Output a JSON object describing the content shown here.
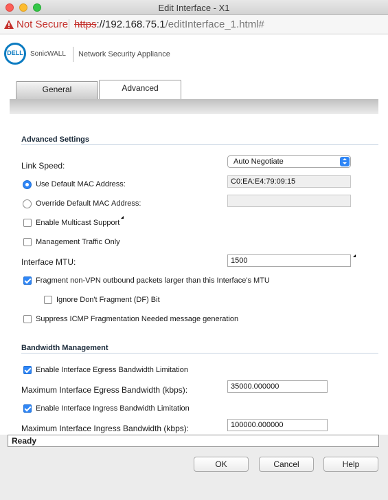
{
  "window": {
    "title": "Edit Interface - X1"
  },
  "address_bar": {
    "security_label": "Not Secure",
    "url_scheme": "https",
    "url_host": "://192.168.75.1",
    "url_path": "/editInterface_1.html#"
  },
  "header": {
    "logo_text": "DELL",
    "brand": "SonicWALL",
    "product": "Network Security Appliance"
  },
  "tabs": [
    {
      "label": "General",
      "active": false
    },
    {
      "label": "Advanced",
      "active": true
    }
  ],
  "advanced_settings": {
    "title": "Advanced Settings",
    "link_speed_label": "Link Speed:",
    "link_speed_value": "Auto Negotiate",
    "use_default_mac_label": "Use Default MAC Address:",
    "default_mac_value": "C0:EA:E4:79:09:15",
    "override_mac_label": "Override Default MAC Address:",
    "override_mac_value": "",
    "multicast_label": "Enable Multicast Support",
    "mgmt_traffic_label": "Management Traffic Only",
    "mtu_label": "Interface MTU:",
    "mtu_value": "1500",
    "fragment_label": "Fragment non-VPN outbound packets larger than this Interface's MTU",
    "ignore_df_label": "Ignore Don't Fragment (DF) Bit",
    "suppress_icmp_label": "Suppress ICMP Fragmentation Needed message generation"
  },
  "bandwidth": {
    "title": "Bandwidth Management",
    "egress_enable_label": "Enable Interface Egress Bandwidth Limitation",
    "egress_max_label": "Maximum Interface Egress Bandwidth (kbps):",
    "egress_value": "35000.000000",
    "ingress_enable_label": "Enable Interface Ingress Bandwidth Limitation",
    "ingress_max_label": "Maximum Interface Ingress Bandwidth (kbps):",
    "ingress_value": "100000.000000"
  },
  "status": {
    "text": "Ready"
  },
  "buttons": {
    "ok": "OK",
    "cancel": "Cancel",
    "help": "Help"
  },
  "colors": {
    "accent": "#2f86f6",
    "brand": "#0b7bc1",
    "warning": "#c4302b"
  }
}
